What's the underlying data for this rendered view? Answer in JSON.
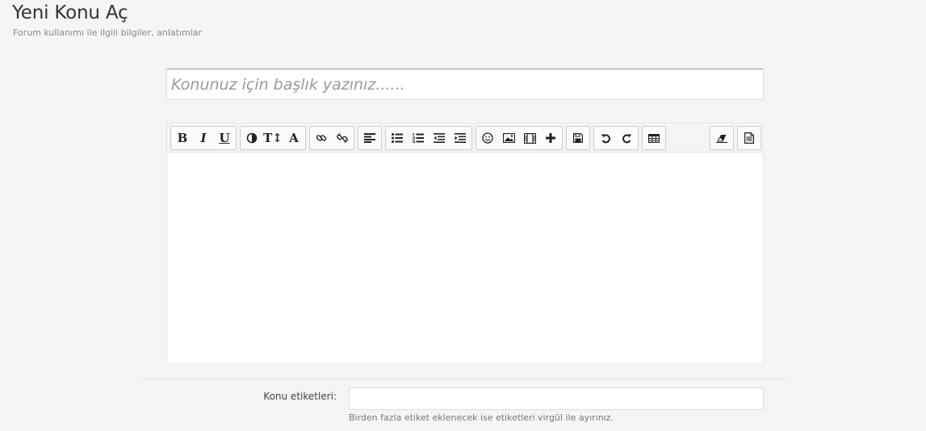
{
  "header": {
    "title": "Yeni Konu Aç",
    "subtitle": "Forum kullanımı ile ilgili bilgiler, anlatımlar"
  },
  "title_field": {
    "placeholder": "Konunuz için başlık yazınız......",
    "value": ""
  },
  "toolbar": {
    "bold": "B",
    "italic": "I",
    "underline": "U",
    "font_size": "T↕",
    "font_name": "A",
    "icons": [
      "bold-icon",
      "italic-icon",
      "underline-icon",
      "color-icon",
      "font-size-icon",
      "font-name-icon",
      "link-icon",
      "unlink-icon",
      "align-left-icon",
      "bullet-list-icon",
      "numbered-list-icon",
      "outdent-icon",
      "indent-icon",
      "emoticon-icon",
      "image-icon",
      "video-icon",
      "plus-icon",
      "save-icon",
      "undo-icon",
      "redo-icon",
      "table-icon",
      "eraser-icon",
      "source-icon"
    ]
  },
  "editor": {
    "content": ""
  },
  "tags": {
    "label": "Konu etiketleri:",
    "value": "",
    "help": "Birden fazla etiket eklenecek ise etiketleri virgül ile ayırınız."
  }
}
